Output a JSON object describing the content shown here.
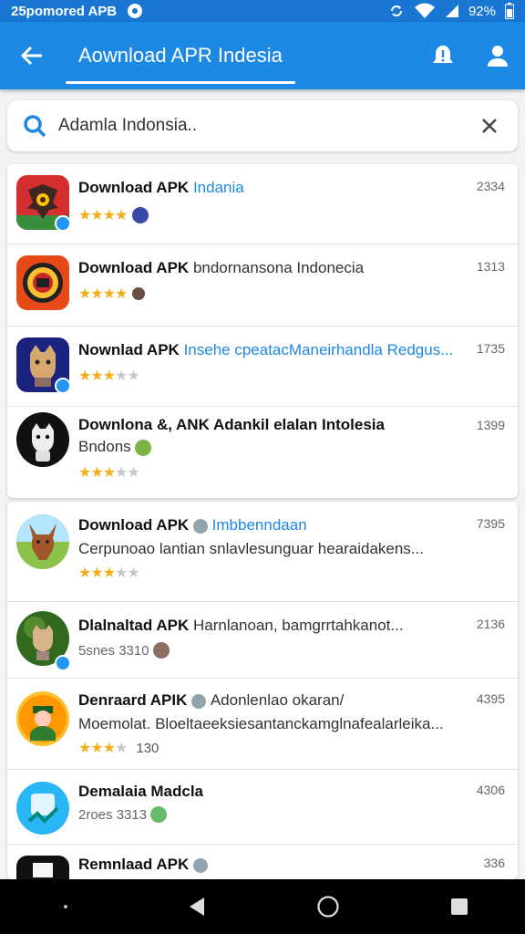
{
  "status_bar": {
    "time": "25pomored APB",
    "battery": "92%"
  },
  "app_bar": {
    "title": "Aownload APR Indesia",
    "accent": "#1e88e5"
  },
  "search": {
    "value": "Adamla Indonsia.."
  },
  "results": [
    {
      "title": "Download APK",
      "subtitle": "Indania",
      "subtitle_style": "blue",
      "stars": 4,
      "number": "2334",
      "icon": "garuda-app-icon"
    },
    {
      "title": "Download APK",
      "subtitle": "bndornansona Indonecia",
      "stars": 4,
      "number": "1313",
      "icon": "emblem-app-icon"
    },
    {
      "title": "Nownlad APK",
      "subtitle": "Insehe cpeatacManeirhandla Redgus...",
      "subtitle_style": "blue",
      "stars": 3,
      "number": "1735",
      "icon": "cat-app-icon"
    },
    {
      "title": "Downlona &, ANK Adankil elalan Intolesia",
      "desc": "Bndons",
      "stars": 3.5,
      "number": "1399",
      "icon": "mascot-app-icon"
    },
    {
      "title": "Download APK",
      "subtitle": "Imbbenndaan",
      "subtitle_style": "blue",
      "desc": "Cerpunoao lantian snlavlesunguar hearaidakens...",
      "stars": 3.5,
      "number": "7395",
      "icon": "deer-app-icon"
    },
    {
      "title": "Dlalnaltad APK",
      "subtitle": "Harnlanoan, bamgrrtahkanot...",
      "meta": "5snes 3310",
      "number": "2136",
      "icon": "forest-app-icon"
    },
    {
      "title": "Denraard APIK",
      "subtitle": "Adonlenlao okaran/",
      "desc": "Moemolat. Bloeltaeeksiesantanckamglnafealarleika...",
      "stars": 4,
      "star_count": "130",
      "number": "4395",
      "icon": "character-app-icon"
    },
    {
      "title": "Demalaia Madcla",
      "meta": "2roes 3313",
      "number": "4306",
      "icon": "blue-round-app-icon"
    },
    {
      "title": "Remnlaad APK",
      "number": "336",
      "icon": "dark-app-icon"
    }
  ]
}
